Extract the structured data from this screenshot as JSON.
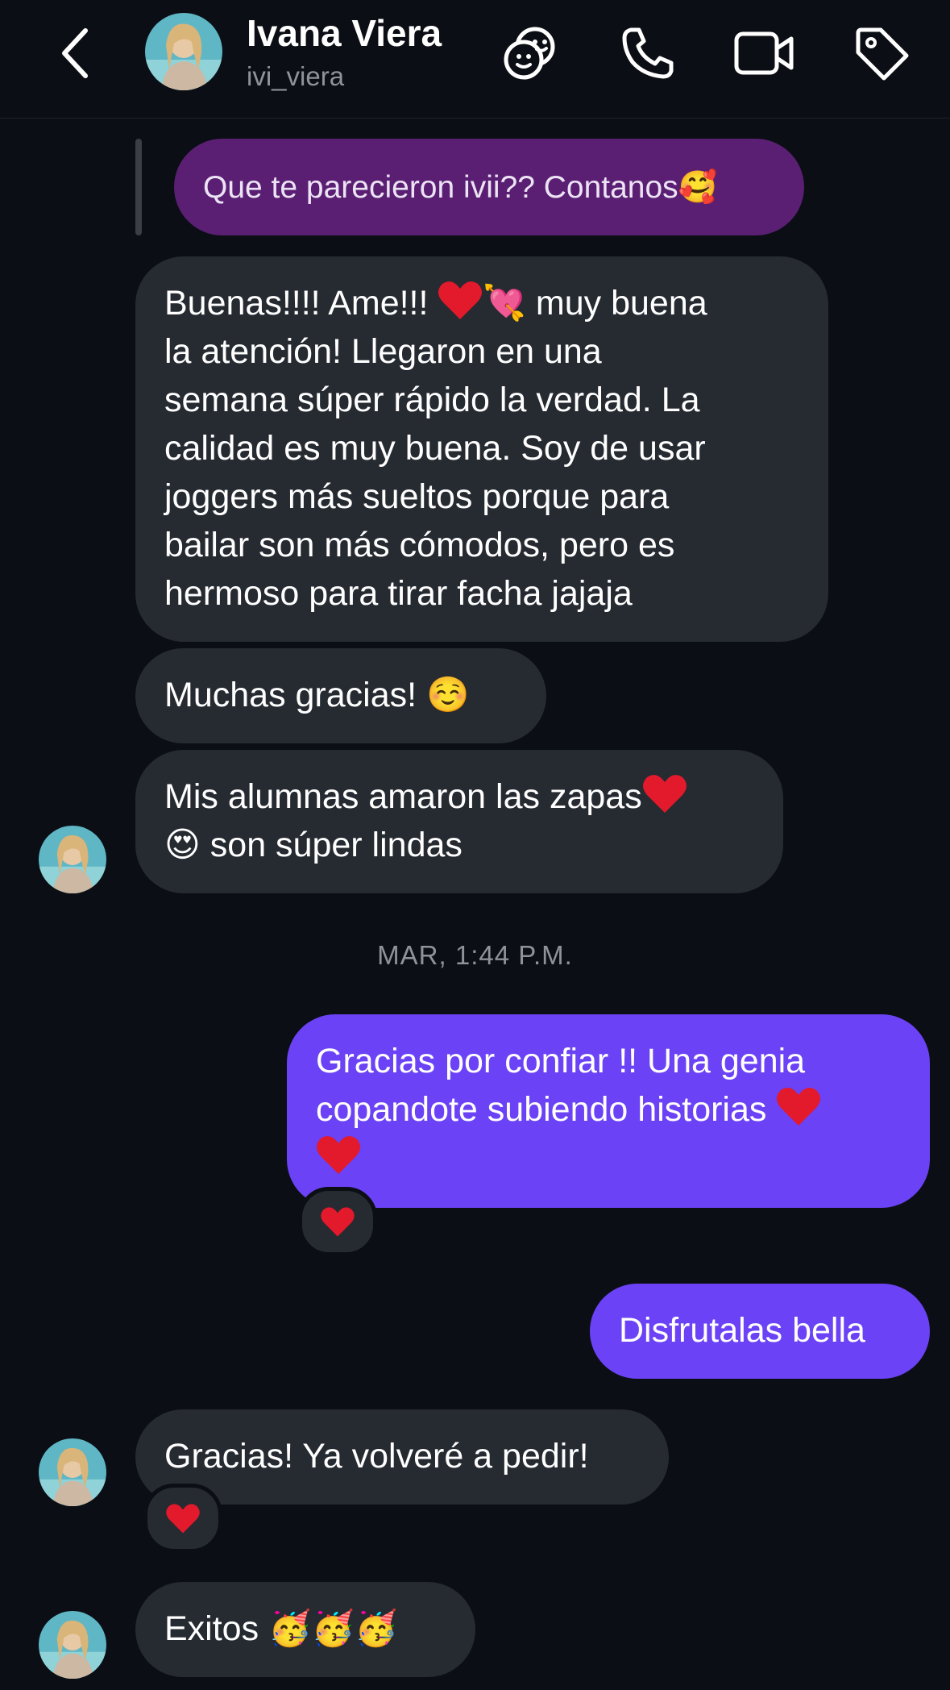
{
  "header": {
    "name": "Ivana Viera",
    "username": "ivi_viera"
  },
  "messages": {
    "reply_preview": "Que te parecieron ivii?? Contanos🥰",
    "m1": {
      "l1a": "Buenas!!!! Ame!!!",
      "l1b": "💘",
      "l1c": " muy buena",
      "l2": "la atención! Llegaron en una",
      "l3": "semana súper rápido la verdad. La",
      "l4": "calidad es muy buena. Soy de usar",
      "l5": "joggers más sueltos porque para",
      "l6": "bailar son más cómodos, pero es",
      "l7": "hermoso para tirar facha jajaja"
    },
    "m2": "Muchas gracias! ☺️",
    "m3": {
      "l1": "Mis alumnas amaron las zapas",
      "l2a": "😍",
      "l2b": " son súper lindas"
    },
    "timestamp": "MAR, 1:44 P.M.",
    "m4": {
      "l1": "Gracias por confiar !! Una genia",
      "l2": "copandote subiendo historias"
    },
    "m5": "Disfrutalas bella",
    "m6": "Gracias! Ya volveré a pedir!",
    "m7": "Exitos 🥳🥳🥳"
  },
  "colors": {
    "background": "#0b0e14",
    "incoming_bubble": "#262a31",
    "outgoing_bubble": "#6b42f5",
    "reply_bubble": "#5a1f73",
    "muted_text": "#8e939b"
  },
  "icons": [
    "back-icon",
    "stickers-icon",
    "phone-icon",
    "video-icon",
    "tag-icon",
    "heart-icon"
  ]
}
